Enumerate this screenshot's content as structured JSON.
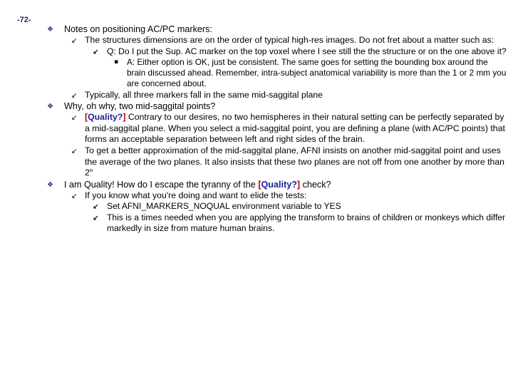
{
  "slide": {
    "page_number": "-72-",
    "page_number_color": "#1f1f7a",
    "background_color": "#ffffff",
    "text_color": "#000000",
    "accent_bracket_color": "#c00000",
    "accent_word_color": "#1f1f9c"
  },
  "bullets": {
    "level1_glyph": "❖",
    "level2_glyph": "↙",
    "level3_glyph": "↙",
    "level4_glyph": "▪"
  },
  "outline": {
    "item1": "Notes on positioning AC/PC markers:",
    "item1_1": "The structures dimensions are on the order of typical high-res images. Do not fret about a matter such as:",
    "item1_1_1": "Q: Do I put the Sup. AC marker on the top voxel where I see still the the structure or on the one above it?",
    "item1_1_1_1": "A: Either option is OK, just be consistent. The same goes for setting the bounding box around the brain discussed ahead. Remember, intra-subject anatomical variability is more than the 1 or 2 mm you are concerned about.",
    "item1_2": "Typically, all three markers fall in the same mid-saggital plane",
    "item2": "Why, oh why, two mid-saggital points?",
    "item2_1_bracket_open": "[",
    "item2_1_word": "Quality?",
    "item2_1_bracket_close": "]",
    "item2_1_rest": " Contrary to our desires, no two hemispheres in their natural setting can be perfectly separated by a mid-saggital plane. When you select a mid-saggital point, you are defining a plane (with AC/PC points) that forms an acceptable separation between left and right sides of the brain.",
    "item2_2_main": "To get a better approximation of the mid-saggital plane, AFNI insists on another mid-saggital point and uses the average of the two planes. It also insists that these two planes are not off from one another by more than 2",
    "item2_2_superscript": "o",
    "item3_pre": "I am Quality! How do I escape the tyranny of the ",
    "item3_bracket_open": "[",
    "item3_word": "Quality?",
    "item3_bracket_close": "]",
    "item3_post": " check?",
    "item3_1": "If you know what you're doing and want to elide the tests:",
    "item3_1_1": "Set AFNI_MARKERS_NOQUAL environment variable to YES",
    "item3_1_2": "This is a times needed when you are applying the transform to brains of children or monkeys which differ markedly in size from mature human brains."
  }
}
